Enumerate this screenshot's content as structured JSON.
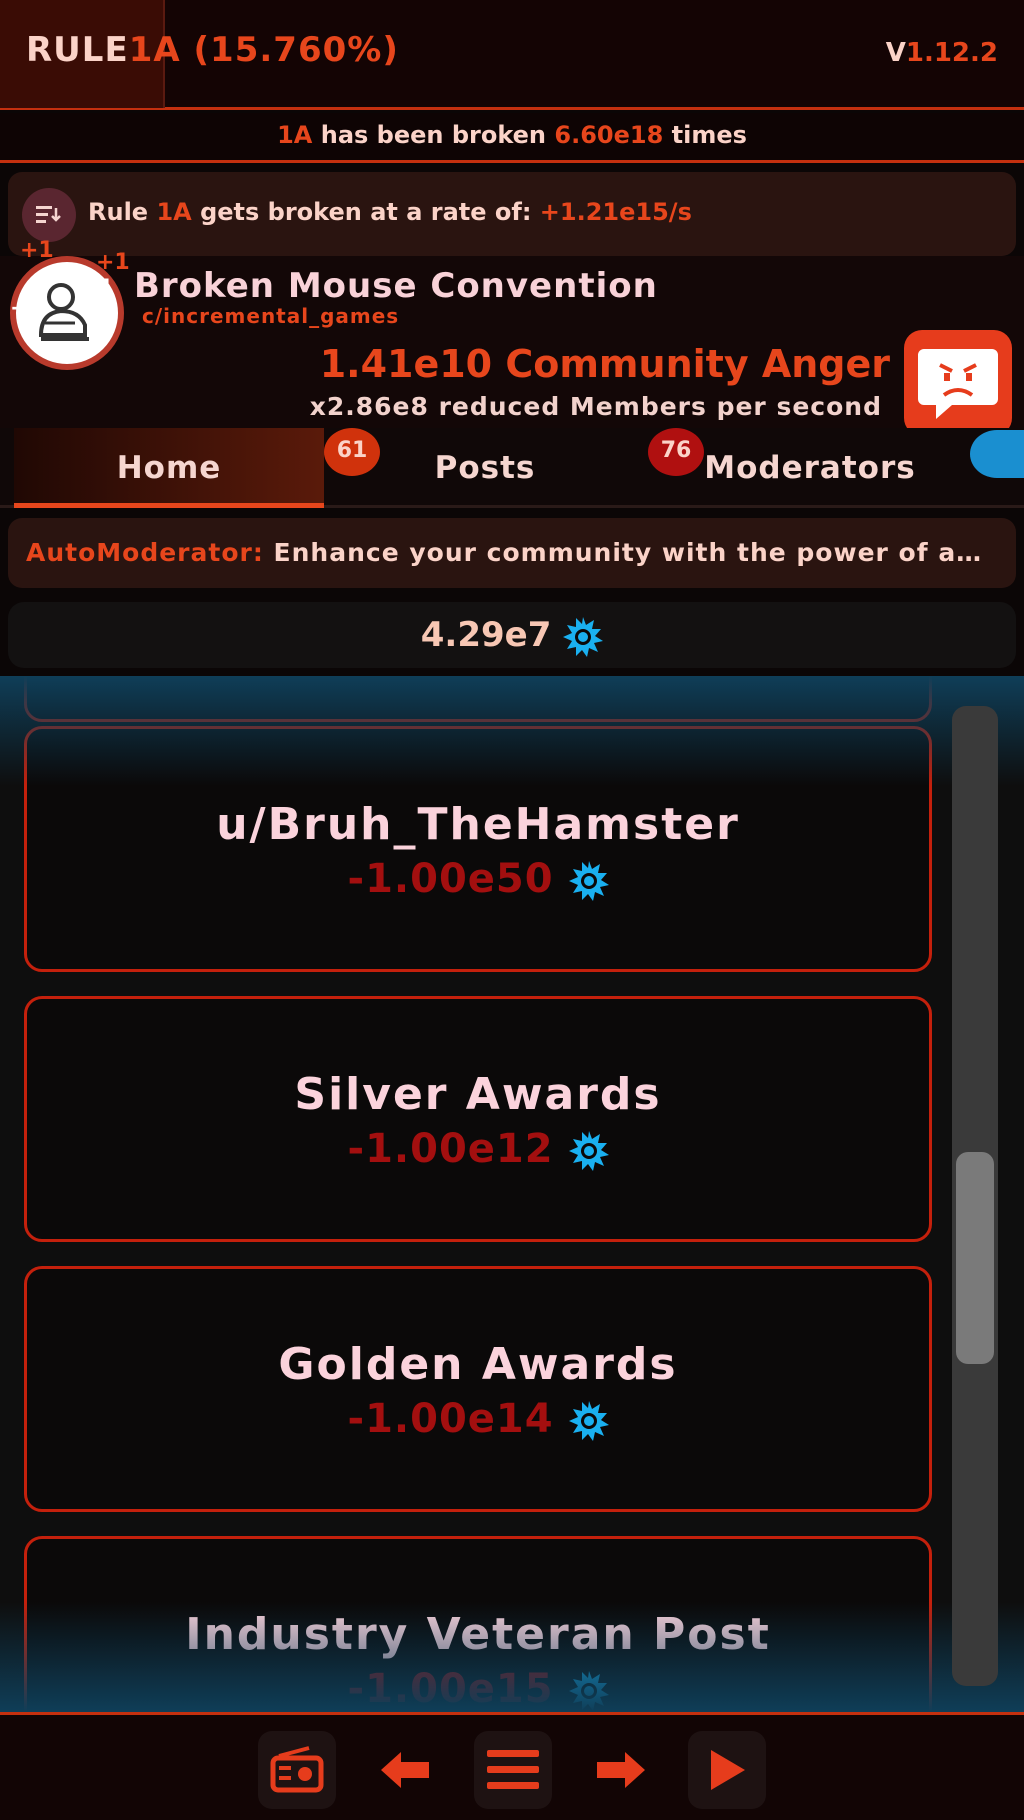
{
  "header": {
    "rule_word": "RULE",
    "rule_code": "1A",
    "rule_percent": "(15.760%)",
    "version_v": "V",
    "version_num": "1.12.2"
  },
  "broken": {
    "code": "1A",
    "mid": "has been broken",
    "count": "6.60e18",
    "tail": "times"
  },
  "rate": {
    "prefix": "Rule",
    "code": "1A",
    "mid": "gets broken at a rate of:",
    "value": "+1.21e15/s"
  },
  "community": {
    "name": "Broken Mouse Convention",
    "subreddit": "c/incremental_games",
    "anger": "1.41e10 Community Anger",
    "anger_effect": "x2.86e8 reduced Members per second",
    "plus_labels": [
      "+1",
      "+1",
      "+1",
      "+1"
    ]
  },
  "tabs": [
    {
      "label": "Home",
      "active": true
    },
    {
      "label": "Posts",
      "badge": "61"
    },
    {
      "label": "Moderators",
      "badge": "76"
    }
  ],
  "automod": {
    "label": "AutoModerator:",
    "text": "Enhance your community with the power of a…"
  },
  "currency": {
    "amount": "4.29e7",
    "icon": "blue-gear-icon"
  },
  "upgrades": [
    {
      "title": "u/Bruh_TheHamster",
      "cost": "-1.00e50"
    },
    {
      "title": "Silver Awards",
      "cost": "-1.00e12"
    },
    {
      "title": "Golden Awards",
      "cost": "-1.00e14"
    },
    {
      "title": "Industry Veteran Post",
      "cost": "-1.00e15"
    }
  ],
  "colors": {
    "accent": "#e7461c",
    "cost": "#a30f0f",
    "gear": "#1ab0f0",
    "background": "#0b0606"
  },
  "bottom_nav": [
    "radio-icon",
    "arrow-left-icon",
    "menu-icon",
    "arrow-right-icon",
    "play-icon"
  ]
}
